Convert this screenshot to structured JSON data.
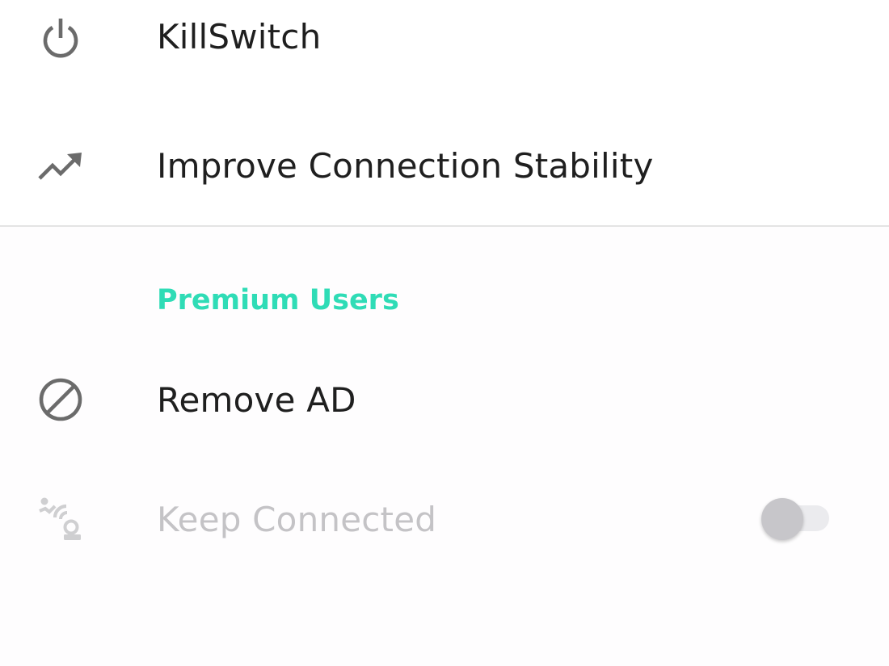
{
  "colors": {
    "text_primary": "#1f1f1f",
    "text_disabled": "#c4c3c6",
    "icon": "#6b6b6b",
    "icon_disabled": "#cfcfd1",
    "accent": "#2fdcb6",
    "divider": "#e4e4e4",
    "toggle_thumb": "#c7c6ca",
    "toggle_track": "#ebebee"
  },
  "menu": {
    "killswitch": {
      "label": "KillSwitch",
      "icon": "power-icon"
    },
    "stability": {
      "label": "Improve Connection Stability",
      "icon": "trending-up-icon"
    }
  },
  "premium": {
    "header": "Premium Users",
    "remove_ad": {
      "label": "Remove AD",
      "icon": "block-icon"
    },
    "keep_connected": {
      "label": "Keep Connected",
      "icon": "keep-connected-icon",
      "enabled": false,
      "toggle_on": false
    }
  }
}
